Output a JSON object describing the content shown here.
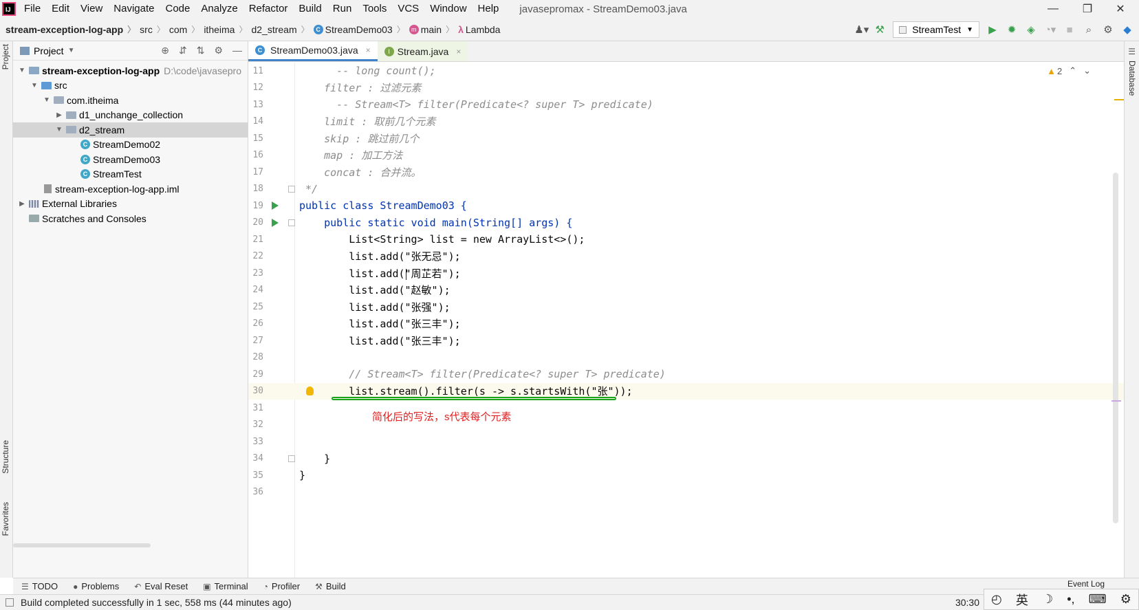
{
  "window": {
    "title": "javasepromax - StreamDemo03.java",
    "controls": [
      "—",
      "❐",
      "✕"
    ]
  },
  "menu": [
    "File",
    "Edit",
    "View",
    "Navigate",
    "Code",
    "Analyze",
    "Refactor",
    "Build",
    "Run",
    "Tools",
    "VCS",
    "Window",
    "Help"
  ],
  "breadcrumb": [
    "stream-exception-log-app",
    "src",
    "com",
    "itheima",
    "d2_stream",
    "StreamDemo03",
    "main",
    "Lambda"
  ],
  "toolbar": {
    "run_config": "StreamTest"
  },
  "project": {
    "title": "Project",
    "tree": [
      {
        "label": "stream-exception-log-app",
        "path": "D:\\code\\javasepro"
      },
      {
        "label": "src"
      },
      {
        "label": "com.itheima"
      },
      {
        "label": "d1_unchange_collection"
      },
      {
        "label": "d2_stream"
      },
      {
        "label": "StreamDemo02"
      },
      {
        "label": "StreamDemo03"
      },
      {
        "label": "StreamTest"
      },
      {
        "label": "stream-exception-log-app.iml"
      },
      {
        "label": "External Libraries"
      },
      {
        "label": "Scratches and Consoles"
      }
    ]
  },
  "side_tabs": {
    "project": "Project",
    "structure": "Structure",
    "favorites": "Favorites",
    "database": "Database"
  },
  "tabs": [
    {
      "label": "StreamDemo03.java",
      "close": "×"
    },
    {
      "label": "Stream.java",
      "close": "×"
    }
  ],
  "editor": {
    "inspections": {
      "warnings": "2"
    },
    "lines": [
      {
        "n": "11",
        "text": "      -- long count();"
      },
      {
        "n": "12",
        "text": "    filter : 过滤元素"
      },
      {
        "n": "13",
        "text": "      -- Stream<T> filter(Predicate<? super T> predicate)"
      },
      {
        "n": "14",
        "text": "    limit : 取前几个元素"
      },
      {
        "n": "15",
        "text": "    skip : 跳过前几个"
      },
      {
        "n": "16",
        "text": "    map : 加工方法"
      },
      {
        "n": "17",
        "text": "    concat : 合并流。"
      },
      {
        "n": "18",
        "text": " */"
      },
      {
        "n": "19",
        "text": "public class StreamDemo03 {"
      },
      {
        "n": "20",
        "text": "    public static void main(String[] args) {"
      },
      {
        "n": "21",
        "text": "        List<String> list = new ArrayList<>();"
      },
      {
        "n": "22",
        "text": "        list.add(\"张无忌\");"
      },
      {
        "n": "23",
        "text": "        list.add(\"周芷若\");"
      },
      {
        "n": "24",
        "text": "        list.add(\"赵敏\");"
      },
      {
        "n": "25",
        "text": "        list.add(\"张强\");"
      },
      {
        "n": "26",
        "text": "        list.add(\"张三丰\");"
      },
      {
        "n": "27",
        "text": "        list.add(\"张三丰\");"
      },
      {
        "n": "28",
        "text": ""
      },
      {
        "n": "29",
        "text": "        // Stream<T> filter(Predicate<? super T> predicate)"
      },
      {
        "n": "30",
        "text": "        list.stream().filter(s -> s.startsWith(\"张\"));"
      },
      {
        "n": "31",
        "text": ""
      },
      {
        "n": "32",
        "text": ""
      },
      {
        "n": "33",
        "text": ""
      },
      {
        "n": "34",
        "text": "    }"
      },
      {
        "n": "35",
        "text": "}"
      },
      {
        "n": "36",
        "text": ""
      }
    ],
    "annotation": "简化后的写法，s代表每个元素"
  },
  "bottom_tabs": [
    "TODO",
    "Problems",
    "Eval Reset",
    "Terminal",
    "Profiler",
    "Build"
  ],
  "event_log": "Event Log",
  "status": {
    "message": "Build completed successfully in 1 sec, 558 ms (44 minutes ago)",
    "caret": "30:30"
  },
  "ime": [
    "英",
    "☽",
    "•,",
    "⌨",
    "⚙"
  ]
}
